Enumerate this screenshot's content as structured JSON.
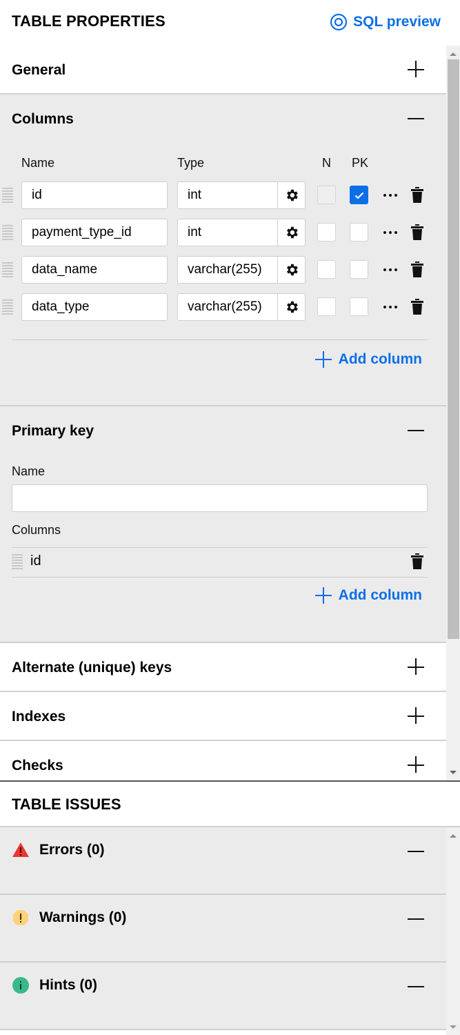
{
  "header": {
    "title": "TABLE PROPERTIES",
    "sql_preview_label": "SQL preview",
    "sql_preview_icon": "eye-icon"
  },
  "colors": {
    "accent": "#0c6fe8",
    "expanded_bg": "#ebebeb",
    "error": "#e8372f",
    "warning": "#fdd27a",
    "hint": "#39b98a"
  },
  "sections": {
    "general": {
      "title": "General",
      "state": "collapsed"
    },
    "columns": {
      "title": "Columns",
      "state": "expanded",
      "headers": {
        "name": "Name",
        "type": "Type",
        "nullable": "N",
        "pk": "PK"
      },
      "rows": [
        {
          "name": "id",
          "type": "int",
          "nullable": false,
          "nullable_disabled": true,
          "pk": true
        },
        {
          "name": "payment_type_id",
          "type": "int",
          "nullable": false,
          "nullable_disabled": false,
          "pk": false
        },
        {
          "name": "data_name",
          "type": "varchar(255)",
          "nullable": false,
          "nullable_disabled": false,
          "pk": false
        },
        {
          "name": "data_type",
          "type": "varchar(255)",
          "nullable": false,
          "nullable_disabled": false,
          "pk": false
        }
      ],
      "add_label": "Add column"
    },
    "primary_key": {
      "title": "Primary key",
      "state": "expanded",
      "name_label": "Name",
      "name_value": "",
      "columns_label": "Columns",
      "columns": [
        "id"
      ],
      "add_label": "Add column"
    },
    "alternate_keys": {
      "title": "Alternate (unique) keys",
      "state": "collapsed"
    },
    "indexes": {
      "title": "Indexes",
      "state": "collapsed"
    },
    "checks": {
      "title": "Checks",
      "state": "collapsed"
    }
  },
  "issues": {
    "title": "TABLE ISSUES",
    "items": [
      {
        "label": "Errors (0)",
        "icon": "error-triangle-icon",
        "state": "expanded"
      },
      {
        "label": "Warnings (0)",
        "icon": "warning-octagon-icon",
        "state": "expanded"
      },
      {
        "label": "Hints (0)",
        "icon": "info-circle-icon",
        "state": "expanded"
      }
    ]
  }
}
